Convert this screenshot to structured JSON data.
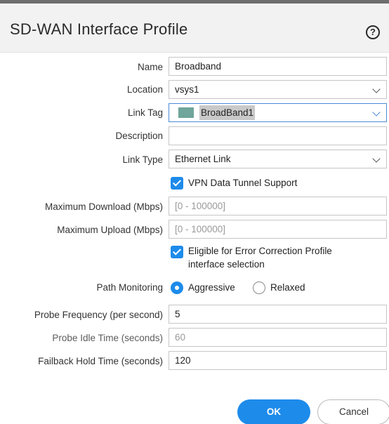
{
  "dialog": {
    "title": "SD-WAN Interface Profile",
    "help_icon": "?"
  },
  "fields": {
    "name": {
      "label": "Name",
      "value": "Broadband"
    },
    "location": {
      "label": "Location",
      "value": "vsys1"
    },
    "link_tag": {
      "label": "Link Tag",
      "value": "BroadBand1",
      "swatch_color": "#6fa59a"
    },
    "description": {
      "label": "Description",
      "value": ""
    },
    "link_type": {
      "label": "Link Type",
      "value": "Ethernet Link"
    },
    "vpn_tunnel": {
      "label": "VPN Data Tunnel Support",
      "checked": true
    },
    "max_download": {
      "label": "Maximum Download (Mbps)",
      "placeholder": "[0 - 100000]"
    },
    "max_upload": {
      "label": "Maximum Upload (Mbps)",
      "placeholder": "[0 - 100000]"
    },
    "error_correction": {
      "label_line1": "Eligible for Error Correction Profile",
      "label_line2": "interface selection",
      "checked": true
    },
    "path_monitoring": {
      "label": "Path Monitoring",
      "options": [
        "Aggressive",
        "Relaxed"
      ],
      "selected": "Aggressive"
    },
    "probe_frequency": {
      "label": "Probe Frequency (per second)",
      "value": "5"
    },
    "probe_idle_time": {
      "label": "Probe Idle Time (seconds)",
      "placeholder": "60"
    },
    "failback_hold_time": {
      "label": "Failback Hold Time (seconds)",
      "value": "120"
    }
  },
  "buttons": {
    "ok": "OK",
    "cancel": "Cancel"
  },
  "colors": {
    "accent": "#1d8bea",
    "header_bg": "#f2f2f2"
  }
}
